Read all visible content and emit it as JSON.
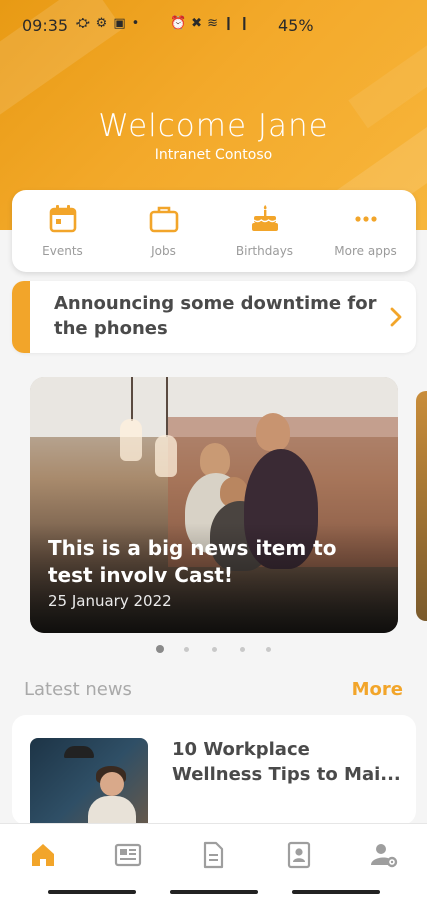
{
  "status_bar": {
    "time": "09:35",
    "left_icons": "⛮⚙▣•",
    "right_icons": "⏰✖≋❙❙",
    "battery": "45%"
  },
  "header": {
    "title": "Welcome Jane",
    "subtitle": "Intranet Contoso",
    "accent_color": "#f2a52a"
  },
  "quick_actions": [
    {
      "label": "Events",
      "icon": "calendar-icon"
    },
    {
      "label": "Jobs",
      "icon": "briefcase-icon"
    },
    {
      "label": "Birthdays",
      "icon": "cake-icon"
    },
    {
      "label": "More apps",
      "icon": "more-horizontal-icon"
    }
  ],
  "announcement": {
    "text": "Announcing some downtime for the phones",
    "icon": "chevron-right-icon"
  },
  "featured_news": {
    "title": "This is a big news item to test involv Cast!",
    "date": "25 January 2022",
    "carousel_count": 5,
    "active_index": 0
  },
  "latest_news": {
    "heading": "Latest news",
    "more_label": "More",
    "items": [
      {
        "title": "10 Workplace Wellness Tips to Mai..."
      }
    ]
  },
  "bottom_nav": [
    {
      "name": "home",
      "icon": "home-icon",
      "active": true
    },
    {
      "name": "news",
      "icon": "news-icon",
      "active": false
    },
    {
      "name": "documents",
      "icon": "document-icon",
      "active": false
    },
    {
      "name": "contacts",
      "icon": "contact-card-icon",
      "active": false
    },
    {
      "name": "settings",
      "icon": "user-settings-icon",
      "active": false
    }
  ]
}
